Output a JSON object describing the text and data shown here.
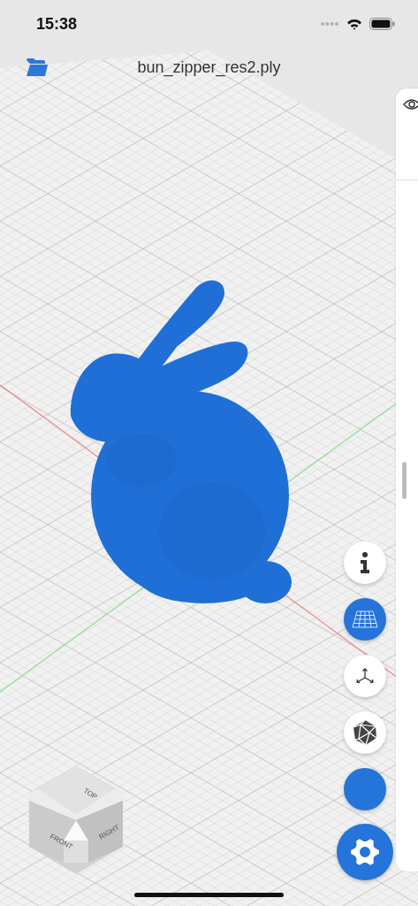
{
  "status_bar": {
    "time": "15:38"
  },
  "nav": {
    "title": "bun_zipper_res2.ply"
  },
  "view_cube": {
    "faces": [
      {
        "kind": "top",
        "label": "TOP"
      },
      {
        "kind": "front",
        "label": "FRONT"
      },
      {
        "kind": "right",
        "label": "RIGHT"
      }
    ]
  },
  "tools": [
    {
      "kind": "info",
      "selected": false
    },
    {
      "kind": "grid",
      "selected": true
    },
    {
      "kind": "axes",
      "selected": false
    },
    {
      "kind": "wireframe",
      "selected": false
    },
    {
      "kind": "color",
      "color": "#2474d9"
    },
    {
      "kind": "settings"
    }
  ]
}
